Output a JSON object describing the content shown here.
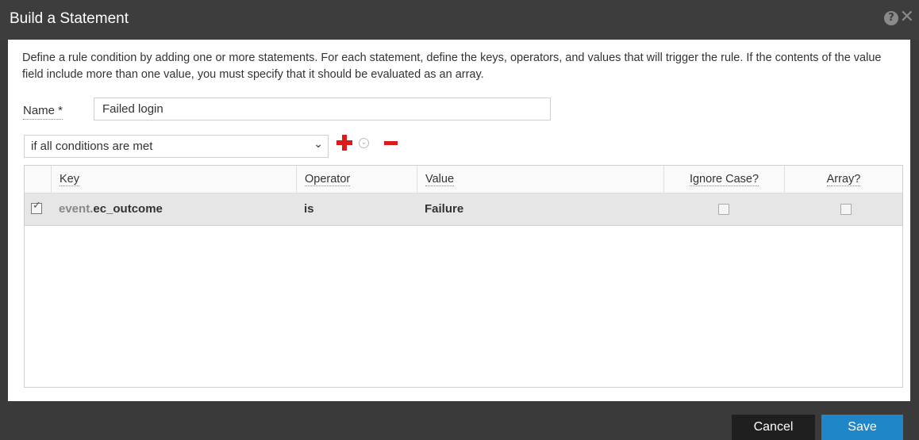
{
  "dialog": {
    "title": "Build a Statement",
    "description": "Define a rule condition by adding one or more statements. For each statement, define the keys, operators, and values that will trigger the rule. If the contents of the value field include more than one value, you must specify that it should be evaluated as an array."
  },
  "form": {
    "name_label": "Name *",
    "name_value": "Failed login",
    "condition_value": "if all conditions are met"
  },
  "table": {
    "columns": [
      "Key",
      "Operator",
      "Value",
      "Ignore Case?",
      "Array?"
    ],
    "rows": [
      {
        "selected": true,
        "key_prefix": "event.",
        "key_name": "ec_outcome",
        "operator": "is",
        "value": "Failure",
        "ignore_case": false,
        "array": false
      }
    ]
  },
  "footer": {
    "cancel_label": "Cancel",
    "save_label": "Save"
  },
  "colors": {
    "accent": "#1f86c7",
    "add_remove": "#d81b1b",
    "titlebar": "#3d3d3d"
  },
  "icons": {
    "help": "help-icon",
    "close": "close-icon",
    "add": "plus-icon",
    "remove": "minus-icon",
    "options": "chevron-down-circle-icon"
  }
}
